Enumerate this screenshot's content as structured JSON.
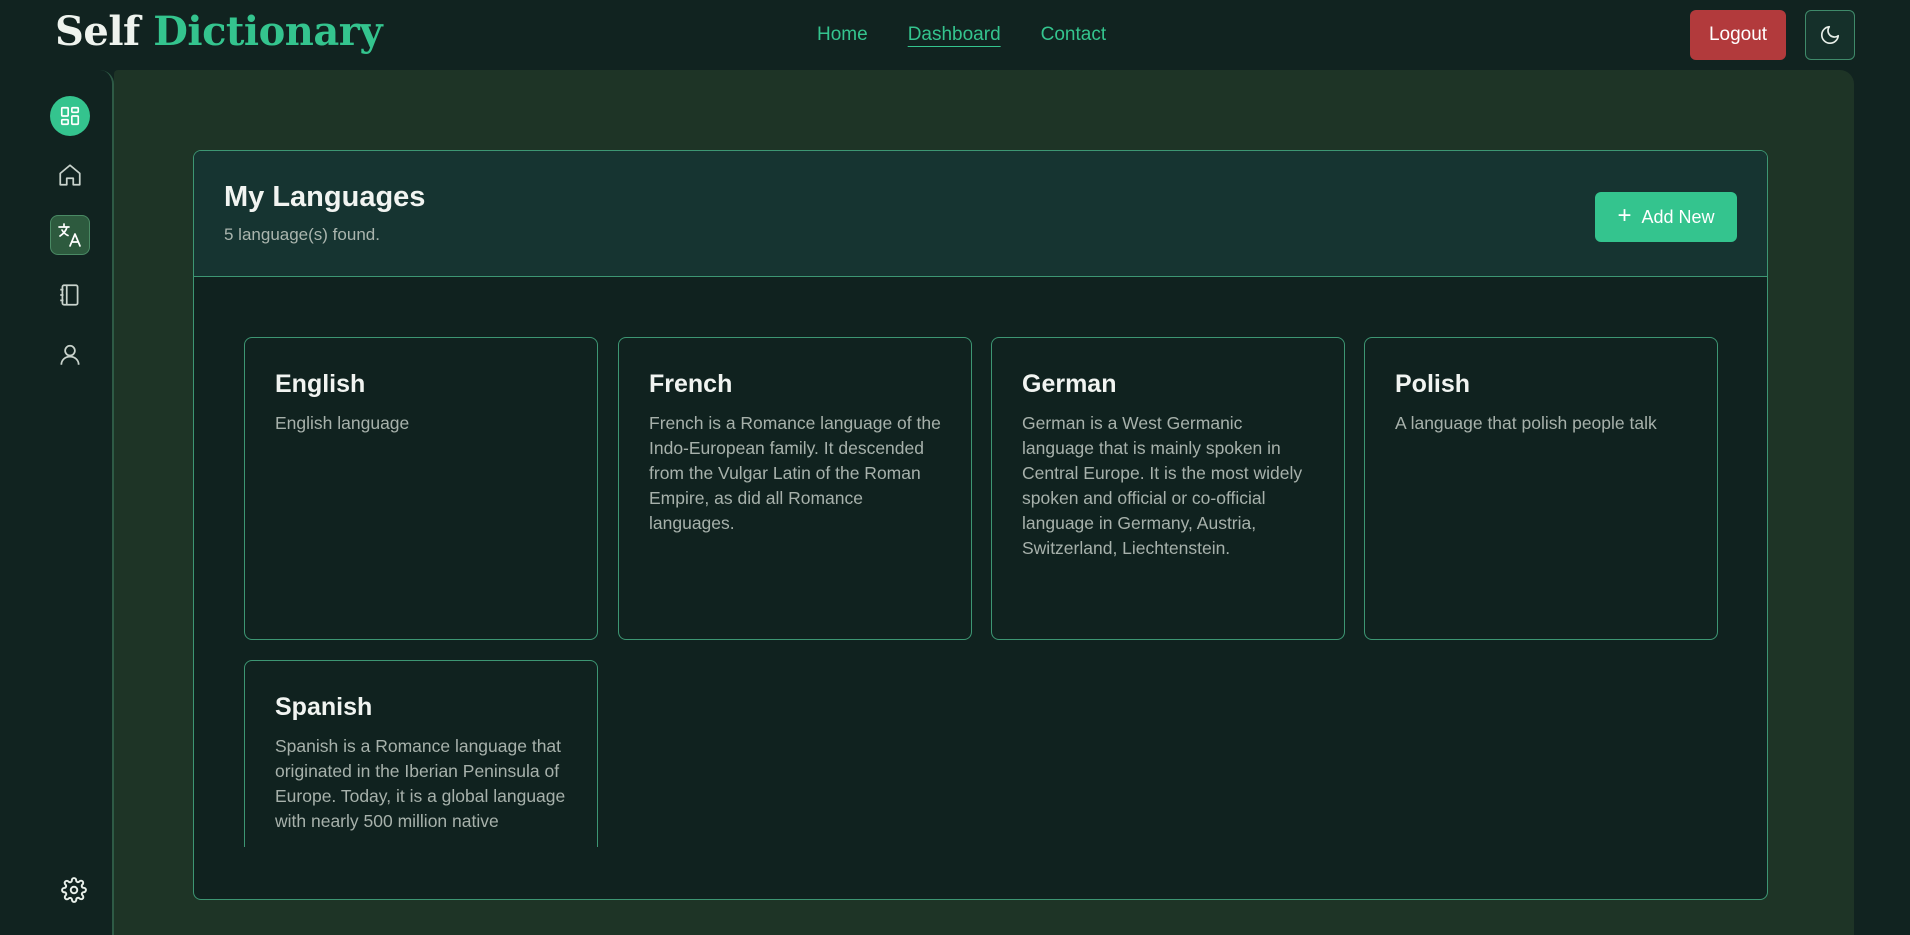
{
  "header": {
    "logo_part1": "Self",
    "logo_part2": "Dictionary",
    "nav": [
      {
        "label": "Home"
      },
      {
        "label": "Dashboard",
        "active": true
      },
      {
        "label": "Contact"
      }
    ],
    "logout_label": "Logout",
    "theme_icon": "moon-icon"
  },
  "sidebar": {
    "items": [
      {
        "icon": "dashboard-icon",
        "active": true
      },
      {
        "icon": "home-icon"
      },
      {
        "icon": "translate-icon",
        "selected": true
      },
      {
        "icon": "notebook-icon"
      },
      {
        "icon": "user-icon"
      }
    ],
    "bottom_icon": "gear-icon"
  },
  "main": {
    "title": "My Languages",
    "subtitle": "5 language(s) found.",
    "add_label": "Add New",
    "languages": [
      {
        "name": "English",
        "description": "English language"
      },
      {
        "name": "French",
        "description": "French is a Romance language of the Indo-European family. It descended from the Vulgar Latin of the Roman Empire, as did all Romance languages."
      },
      {
        "name": "German",
        "description": "German is a West Germanic language that is mainly spoken in Central Europe. It is the most widely spoken and official or co-official language in Germany, Austria, Switzerland, Liechtenstein."
      },
      {
        "name": "Polish",
        "description": "A language that polish people talk"
      },
      {
        "name": "Spanish",
        "description": "Spanish is a Romance language that originated in the Iberian Peninsula of Europe. Today, it is a global language with nearly 500 million native"
      }
    ]
  },
  "colors": {
    "accent": "#34c48e",
    "logout": "#b23a3c",
    "background": "#112320",
    "panel": "#10221f"
  }
}
